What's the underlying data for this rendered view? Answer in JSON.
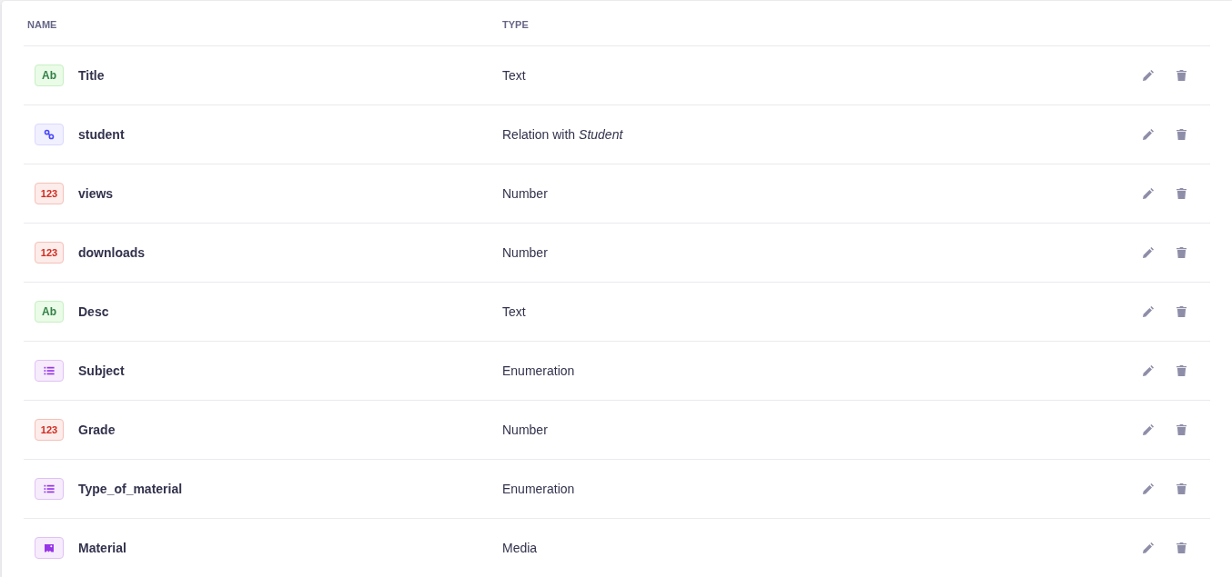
{
  "table": {
    "columns": [
      {
        "label": "NAME"
      },
      {
        "label": "TYPE"
      }
    ],
    "rows": [
      {
        "kind": "text",
        "badge": "Ab",
        "name": "Title",
        "type": "Text"
      },
      {
        "kind": "relation",
        "name": "student",
        "type": "Relation with *Student*"
      },
      {
        "kind": "number",
        "badge": "123",
        "name": "views",
        "type": "Number"
      },
      {
        "kind": "number",
        "badge": "123",
        "name": "downloads",
        "type": "Number"
      },
      {
        "kind": "text",
        "badge": "Ab",
        "name": "Desc",
        "type": "Text"
      },
      {
        "kind": "enumeration",
        "name": "Subject",
        "type": "Enumeration"
      },
      {
        "kind": "number",
        "badge": "123",
        "name": "Grade",
        "type": "Number"
      },
      {
        "kind": "enumeration",
        "name": "Type_of_material",
        "type": "Enumeration"
      },
      {
        "kind": "media",
        "name": "Material",
        "type": "Media"
      }
    ]
  }
}
